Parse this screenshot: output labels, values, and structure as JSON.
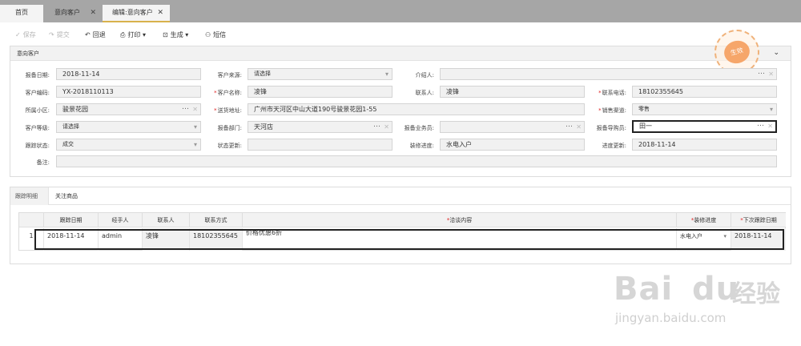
{
  "tabs": [
    {
      "label": "首页"
    },
    {
      "label": "意向客户",
      "close": "✕"
    },
    {
      "label": "编辑:意向客户",
      "close": "✕"
    }
  ],
  "toolbar": {
    "save": "保存",
    "submit": "提交",
    "back": "回退",
    "print": "打印",
    "generate": "生成",
    "sms": "短信"
  },
  "panel1": {
    "title": "意向客户",
    "stamp": "生效"
  },
  "form": {
    "report_date_label": "报备日期:",
    "report_date": "2018-11-14",
    "source_label": "客户来源:",
    "source": "请选择",
    "referrer_label": "介绍人:",
    "referrer": "",
    "code_label": "客户编码:",
    "code": "YX-2018110113",
    "name_label": "客户名称:",
    "name": "凌锋",
    "contact_label": "联系人:",
    "contact": "凌锋",
    "phone_label": "联系电话:",
    "phone": "18102355645",
    "community_label": "所属小区:",
    "community": "骏景花园",
    "address_label": "送货地址:",
    "address": "广州市天河区中山大道190号骏景花园1-55",
    "channel_label": "销售渠道:",
    "channel": "零售",
    "level_label": "客户等级:",
    "level": "请选择",
    "dept_label": "报备部门:",
    "dept": "天河店",
    "salesman_label": "报备业务员:",
    "salesman": "",
    "guide_label": "报备导购员:",
    "guide": "田一",
    "track_label": "跟踪状态:",
    "track": "成交",
    "status_update_label": "状态更新:",
    "status_update": "",
    "deco_label": "装修进度:",
    "deco": "水电入户",
    "progress_update_label": "进度更新:",
    "progress_update": "2018-11-14",
    "remark_label": "备注:",
    "remark": ""
  },
  "panel2": {
    "tabs": [
      "跟踪明细",
      "关注商品"
    ]
  },
  "grid": {
    "headers": [
      "跟踪日期",
      "经手人",
      "联系人",
      "联系方式",
      "洽谈内容",
      "装修进度",
      "下次跟踪日期"
    ],
    "rows": [
      {
        "no": "1",
        "date": "2018-11-14",
        "handler": "admin",
        "contact": "凌锋",
        "phone": "18102355645",
        "content": "价格优惠6折",
        "deco": "水电入户",
        "next_date": "2018-11-14"
      }
    ]
  },
  "watermark": {
    "brand": "Bai",
    "brand2": "du",
    "cn": "经验",
    "url": "jingyan.baidu.com"
  }
}
